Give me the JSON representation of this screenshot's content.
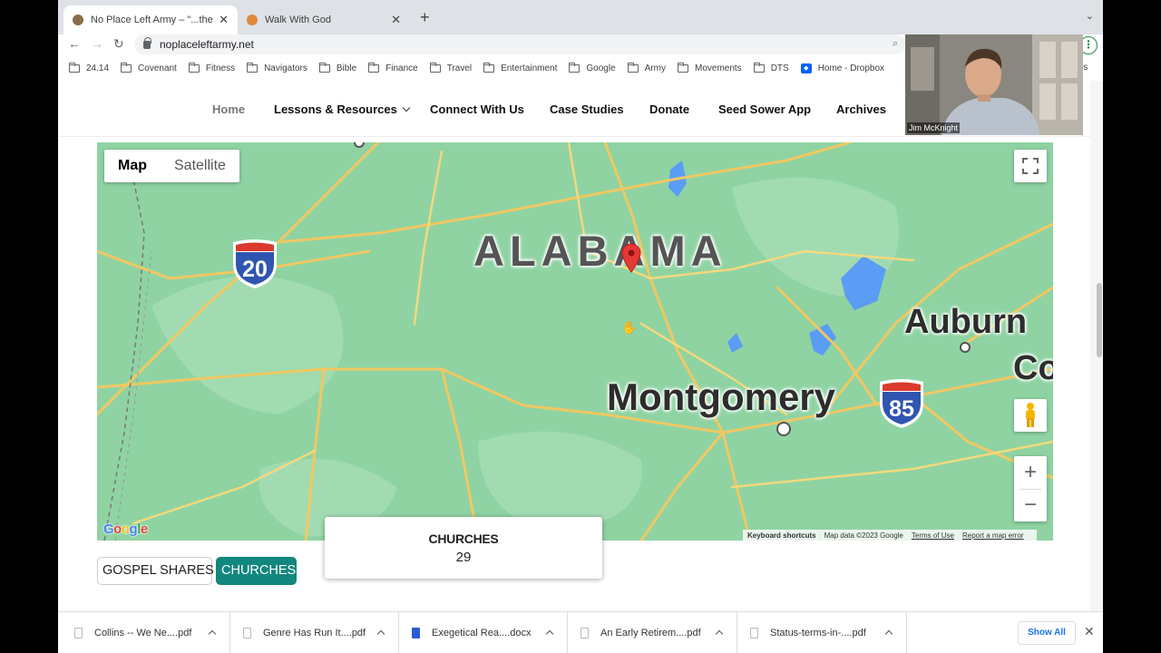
{
  "browser": {
    "tabs": [
      {
        "title": "No Place Left Army – \"...there",
        "active": true
      },
      {
        "title": "Walk With God",
        "active": false
      }
    ],
    "url": "noplaceleftarmy.net",
    "bookmarks": [
      "24.14",
      "Covenant",
      "Fitness",
      "Navigators",
      "Bible",
      "Finance",
      "Travel",
      "Entertainment",
      "Google",
      "Army",
      "Movements",
      "DTS",
      "Home - Dropbox"
    ],
    "bookmarks_overflow": "rks"
  },
  "site_nav": {
    "items": [
      "Home",
      "Lessons & Resources",
      "Connect With Us",
      "Case Studies",
      "Donate",
      "Seed Sower App",
      "Archives"
    ]
  },
  "map": {
    "type_buttons": [
      "Map",
      "Satellite"
    ],
    "selected_type": "Map",
    "state_label": "ALABAMA",
    "cities": [
      "Auburn",
      "Montgomery",
      "Co"
    ],
    "shields": [
      "20",
      "85"
    ],
    "zoom_in": "+",
    "zoom_out": "−",
    "google_logo": "Google",
    "attribution": [
      "Keyboard shortcuts",
      "Map data ©2023 Google",
      "Terms of Use",
      "Report a map error"
    ],
    "colors": {
      "land": "#8fd3a3",
      "road": "#f6c85f",
      "water": "#5b9cf5",
      "pin": "#e53935"
    }
  },
  "info_card": {
    "title": "CHURCHES",
    "count": "29"
  },
  "filters": {
    "gospel": "GOSPEL SHARES",
    "churches": "CHURCHES"
  },
  "downloads": {
    "items": [
      "Collins -- We Ne....pdf",
      "Genre Has Run It....pdf",
      "Exegetical Rea....docx",
      "An Early Retirem....pdf",
      "Status-terms-in-....pdf"
    ],
    "show_all": "Show All"
  },
  "webcam": {
    "name": "Jim McKnight"
  }
}
